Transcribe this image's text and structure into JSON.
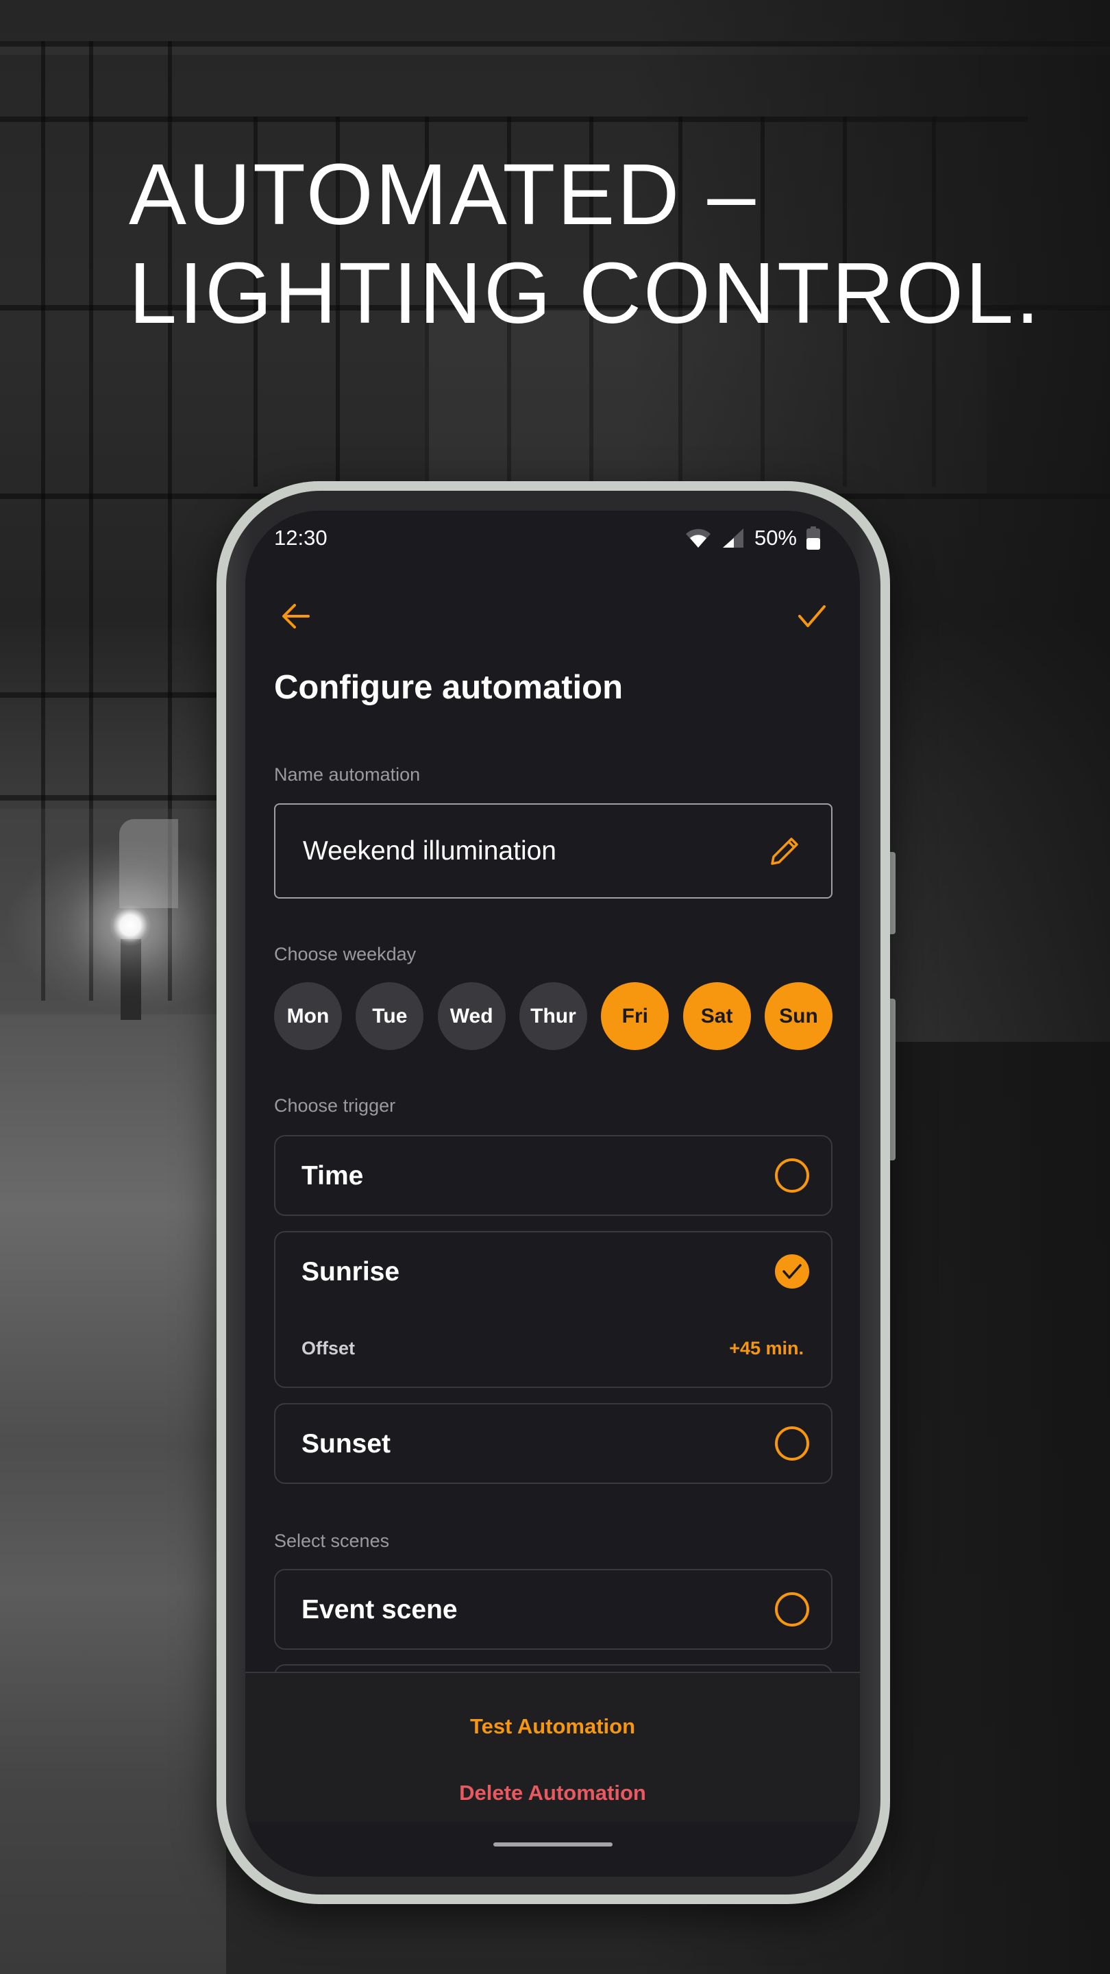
{
  "headline": {
    "line1": "AUTOMATED –",
    "line2": "LIGHTING CONTROL."
  },
  "status_bar": {
    "time": "12:30",
    "wifi_icon": "wifi-icon",
    "signal_icon": "cellular-signal-icon",
    "battery_percent": "50%",
    "battery_level": 0.5,
    "battery_icon": "battery-icon"
  },
  "app_bar": {
    "back_icon": "arrow-left-icon",
    "confirm_icon": "checkmark-icon"
  },
  "page": {
    "title": "Configure automation"
  },
  "name_section": {
    "label": "Name automation",
    "value": "Weekend illumination",
    "edit_icon": "pencil-icon"
  },
  "weekday_section": {
    "label": "Choose weekday",
    "days": [
      {
        "label": "Mon",
        "selected": false
      },
      {
        "label": "Tue",
        "selected": false
      },
      {
        "label": "Wed",
        "selected": false
      },
      {
        "label": "Thur",
        "selected": false
      },
      {
        "label": "Fri",
        "selected": true
      },
      {
        "label": "Sat",
        "selected": true
      },
      {
        "label": "Sun",
        "selected": true
      }
    ]
  },
  "trigger_section": {
    "label": "Choose trigger",
    "options": [
      {
        "label": "Time",
        "selected": false
      },
      {
        "label": "Sunrise",
        "selected": true,
        "offset_label": "Offset",
        "offset_value": "+45 min."
      },
      {
        "label": "Sunset",
        "selected": false
      }
    ]
  },
  "scenes_section": {
    "label": "Select scenes",
    "options": [
      {
        "label": "Event scene",
        "selected": false
      }
    ]
  },
  "actions": {
    "test_label": "Test Automation",
    "delete_label": "Delete Automation"
  },
  "colors": {
    "accent": "#F7960F",
    "danger": "#E85A5F",
    "screen_background": "#1B1B1F",
    "unselected_day": "#3A3A3E"
  }
}
